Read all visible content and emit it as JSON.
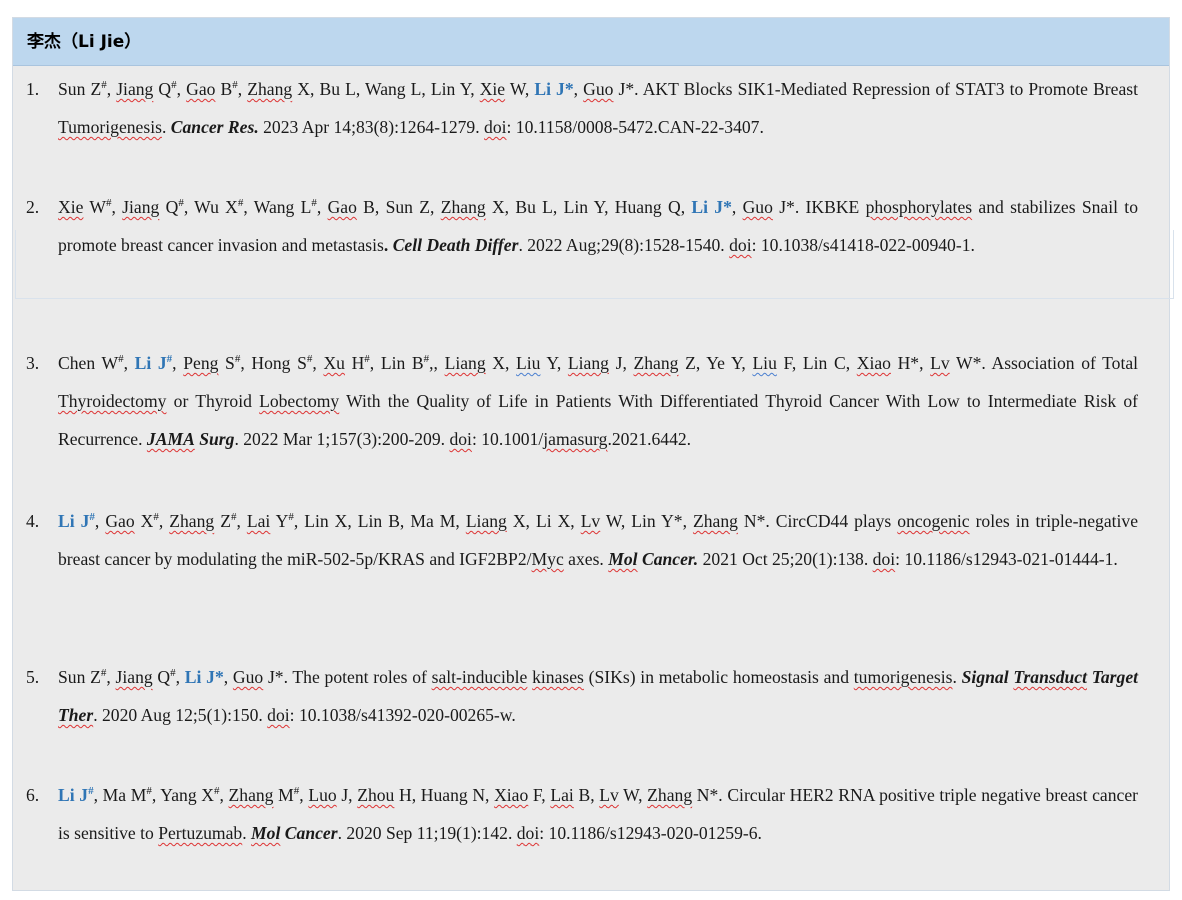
{
  "section": {
    "title": "李杰（Li Jie）"
  },
  "publications": [
    {
      "number": "1.",
      "segments": [
        {
          "t": "Sun Z"
        },
        {
          "t": "#",
          "s": "sup"
        },
        {
          "t": ", "
        },
        {
          "t": "Jiang",
          "s": "sq"
        },
        {
          "t": " Q"
        },
        {
          "t": "#",
          "s": "sup"
        },
        {
          "t": ", "
        },
        {
          "t": "Gao",
          "s": "sq"
        },
        {
          "t": " B"
        },
        {
          "t": "#",
          "s": "sup"
        },
        {
          "t": ", "
        },
        {
          "t": "Zhang",
          "s": "sq"
        },
        {
          "t": " X, Bu L, Wang L, Lin Y, "
        },
        {
          "t": "Xie",
          "s": "sq"
        },
        {
          "t": " W, "
        },
        {
          "t": "Li J*",
          "s": "hl"
        },
        {
          "t": ", "
        },
        {
          "t": "Guo",
          "s": "sq"
        },
        {
          "t": " J*. AKT Blocks SIK1-Mediated Repression of STAT3 to Promote Breast "
        },
        {
          "t": "Tumorigenesis",
          "s": "sq"
        },
        {
          "t": ". "
        },
        {
          "t": "Cancer Res.",
          "s": "jn"
        },
        {
          "t": " 2023 Apr 14;83(8):1264-1279. "
        },
        {
          "t": "doi",
          "s": "sq"
        },
        {
          "t": ": 10.1158/0008-5472.CAN-22-3407."
        }
      ]
    },
    {
      "number": "2.",
      "segments": [
        {
          "t": "Xie",
          "s": "sq"
        },
        {
          "t": " W"
        },
        {
          "t": "#",
          "s": "sup"
        },
        {
          "t": ", "
        },
        {
          "t": "Jiang",
          "s": "sq"
        },
        {
          "t": " Q"
        },
        {
          "t": "#",
          "s": "sup"
        },
        {
          "t": ", Wu X"
        },
        {
          "t": "#",
          "s": "sup"
        },
        {
          "t": ", Wang L"
        },
        {
          "t": "#",
          "s": "sup"
        },
        {
          "t": ", "
        },
        {
          "t": "Gao",
          "s": "sq"
        },
        {
          "t": " B, Sun Z, "
        },
        {
          "t": "Zhang",
          "s": "sq"
        },
        {
          "t": " X, Bu L, Lin Y, Huang Q, "
        },
        {
          "t": "Li J*",
          "s": "hl"
        },
        {
          "t": ", "
        },
        {
          "t": "Guo",
          "s": "sq"
        },
        {
          "t": " J*. IKBKE "
        },
        {
          "t": "phosphorylates",
          "s": "sq"
        },
        {
          "t": " and stabilizes Snail to promote breast cancer invasion and metastasis"
        },
        {
          "t": ".",
          "s": "bold"
        },
        {
          "t": " "
        },
        {
          "t": "Cell Death Differ",
          "s": "jn"
        },
        {
          "t": ". 2022 Aug;29(8):1528-1540. "
        },
        {
          "t": "doi",
          "s": "sq"
        },
        {
          "t": ": 10.1038/s41418-022-00940-1."
        }
      ]
    },
    {
      "number": "3.",
      "segments": [
        {
          "t": "Chen W"
        },
        {
          "t": "#",
          "s": "sup"
        },
        {
          "t": ", "
        },
        {
          "t": "Li J",
          "s": "hl"
        },
        {
          "t": "#",
          "s": "hlsup"
        },
        {
          "t": ", "
        },
        {
          "t": "Peng",
          "s": "sq"
        },
        {
          "t": " S"
        },
        {
          "t": "#",
          "s": "sup"
        },
        {
          "t": ", Hong S"
        },
        {
          "t": "#",
          "s": "sup"
        },
        {
          "t": ", "
        },
        {
          "t": "Xu",
          "s": "sq"
        },
        {
          "t": " H"
        },
        {
          "t": "#",
          "s": "sup"
        },
        {
          "t": ", Lin B"
        },
        {
          "t": "#",
          "s": "sup"
        },
        {
          "t": ",, "
        },
        {
          "t": "Liang",
          "s": "sq"
        },
        {
          "t": " X, "
        },
        {
          "t": "Liu",
          "s": "sqb"
        },
        {
          "t": " Y, "
        },
        {
          "t": "Liang",
          "s": "sq"
        },
        {
          "t": " J, "
        },
        {
          "t": "Zhang",
          "s": "sq"
        },
        {
          "t": " Z, Ye Y, "
        },
        {
          "t": "Liu",
          "s": "sqb"
        },
        {
          "t": " F, Lin C, "
        },
        {
          "t": "Xiao",
          "s": "sq"
        },
        {
          "t": " H*, "
        },
        {
          "t": "Lv",
          "s": "sq"
        },
        {
          "t": " W*. Association of Total "
        },
        {
          "t": "Thyroidectomy",
          "s": "sq"
        },
        {
          "t": " or Thyroid "
        },
        {
          "t": "Lobectomy",
          "s": "sq"
        },
        {
          "t": " With the Quality of Life in Patients With Differentiated Thyroid Cancer With Low to Intermediate Risk of Recurrence. "
        },
        {
          "t": "JAMA",
          "s": "jnsq"
        },
        {
          "t": " "
        },
        {
          "t": "Surg",
          "s": "jn"
        },
        {
          "t": ". 2022 Mar 1;157(3):200-209. "
        },
        {
          "t": "doi",
          "s": "sq"
        },
        {
          "t": ": 10.1001/"
        },
        {
          "t": "jamasurg",
          "s": "sq"
        },
        {
          "t": ".2021.6442."
        }
      ]
    },
    {
      "number": "4.",
      "segments": [
        {
          "t": "Li J",
          "s": "hl"
        },
        {
          "t": "#",
          "s": "hlsup"
        },
        {
          "t": ", "
        },
        {
          "t": "Gao",
          "s": "sq"
        },
        {
          "t": " X"
        },
        {
          "t": "#",
          "s": "sup"
        },
        {
          "t": ", "
        },
        {
          "t": "Zhang",
          "s": "sq"
        },
        {
          "t": " Z"
        },
        {
          "t": "#",
          "s": "sup"
        },
        {
          "t": ", "
        },
        {
          "t": "Lai",
          "s": "sq"
        },
        {
          "t": " Y"
        },
        {
          "t": "#",
          "s": "sup"
        },
        {
          "t": ", Lin X, Lin B, Ma M, "
        },
        {
          "t": "Liang",
          "s": "sq"
        },
        {
          "t": " X, Li X, "
        },
        {
          "t": "Lv",
          "s": "sq"
        },
        {
          "t": " W, Lin Y*, "
        },
        {
          "t": "Zhang",
          "s": "sq"
        },
        {
          "t": " N*. CircCD44 plays "
        },
        {
          "t": "oncogenic",
          "s": "sq"
        },
        {
          "t": " roles in triple-negative breast cancer by modulating the miR-502-5p/KRAS and IGF2BP2/"
        },
        {
          "t": "Myc",
          "s": "sq"
        },
        {
          "t": " axes. "
        },
        {
          "t": "Mol",
          "s": "jnsq"
        },
        {
          "t": " "
        },
        {
          "t": "Cancer.",
          "s": "jn"
        },
        {
          "t": " 2021 Oct 25;20(1):138. "
        },
        {
          "t": "doi",
          "s": "sq"
        },
        {
          "t": ": 10.1186/s12943-021-01444-1."
        }
      ]
    },
    {
      "number": "5.",
      "segments": [
        {
          "t": "Sun Z"
        },
        {
          "t": "#",
          "s": "sup"
        },
        {
          "t": ", "
        },
        {
          "t": "Jiang",
          "s": "sq"
        },
        {
          "t": " Q"
        },
        {
          "t": "#",
          "s": "sup"
        },
        {
          "t": ", "
        },
        {
          "t": "Li J*",
          "s": "hl"
        },
        {
          "t": ", "
        },
        {
          "t": "Guo",
          "s": "sq"
        },
        {
          "t": " J*. The potent roles of "
        },
        {
          "t": "salt-inducible",
          "s": "sq"
        },
        {
          "t": " "
        },
        {
          "t": "kinases",
          "s": "sq"
        },
        {
          "t": " (SIKs) in metabolic homeostasis and "
        },
        {
          "t": "tumorigenesis",
          "s": "sq"
        },
        {
          "t": ". "
        },
        {
          "t": "Signal",
          "s": "jn"
        },
        {
          "t": " "
        },
        {
          "t": "Transduct",
          "s": "jnsq"
        },
        {
          "t": " "
        },
        {
          "t": "Target",
          "s": "jn"
        },
        {
          "t": " "
        },
        {
          "t": "Ther",
          "s": "jnsq"
        },
        {
          "t": ". 2020 Aug 12;5(1):150. "
        },
        {
          "t": "doi",
          "s": "sq"
        },
        {
          "t": ": 10.1038/s41392-020-00265-w."
        }
      ]
    },
    {
      "number": "6.",
      "segments": [
        {
          "t": "Li J",
          "s": "hl"
        },
        {
          "t": "#",
          "s": "hlsup"
        },
        {
          "t": ", Ma M"
        },
        {
          "t": "#",
          "s": "sup"
        },
        {
          "t": ", Yang X"
        },
        {
          "t": "#",
          "s": "sup"
        },
        {
          "t": ", "
        },
        {
          "t": "Zhang",
          "s": "sq"
        },
        {
          "t": " M"
        },
        {
          "t": "#",
          "s": "sup"
        },
        {
          "t": ", "
        },
        {
          "t": "Luo",
          "s": "sq"
        },
        {
          "t": " J, "
        },
        {
          "t": "Zhou",
          "s": "sq"
        },
        {
          "t": " H, Huang N, "
        },
        {
          "t": "Xiao",
          "s": "sq"
        },
        {
          "t": " F, "
        },
        {
          "t": "Lai",
          "s": "sq"
        },
        {
          "t": " B, "
        },
        {
          "t": "Lv",
          "s": "sq"
        },
        {
          "t": " W, "
        },
        {
          "t": "Zhang",
          "s": "sq"
        },
        {
          "t": " N*. Circular HER2 RNA positive triple negative breast cancer is sensitive to "
        },
        {
          "t": "Pertuzumab",
          "s": "sq"
        },
        {
          "t": ". "
        },
        {
          "t": "Mol",
          "s": "jnsq"
        },
        {
          "t": " "
        },
        {
          "t": "Cancer",
          "s": "jn"
        },
        {
          "t": ". 2020 Sep 11;19(1):142. "
        },
        {
          "t": "doi",
          "s": "sq"
        },
        {
          "t": ": 10.1186/s12943-020-01259-6."
        }
      ]
    }
  ]
}
